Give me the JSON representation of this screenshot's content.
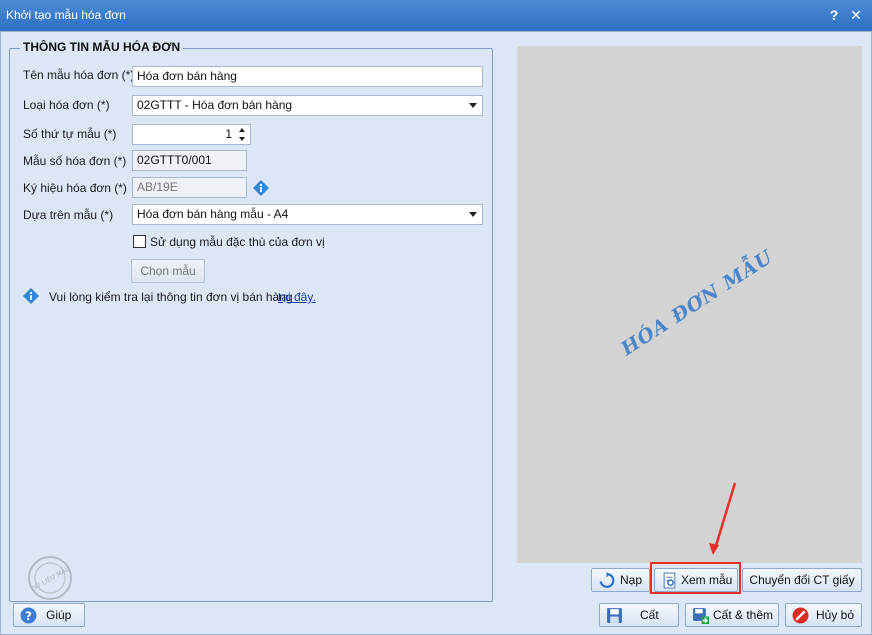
{
  "window": {
    "title": "Khởi tạo mẫu hóa đơn",
    "help_glyph": "?",
    "close_glyph": "✕"
  },
  "form": {
    "group_title": "THÔNG TIN MẪU HÓA ĐƠN",
    "ten_mau_label": "Tên mẫu hóa đơn (*)",
    "ten_mau_value": "Hóa đơn bán hàng",
    "loai_hd_label": "Loại hóa đơn (*)",
    "loai_hd_value": "02GTTT - Hóa đơn bán hàng",
    "so_thu_tu_label": "Số thứ tự mẫu (*)",
    "so_thu_tu_value": "1",
    "mau_so_label": "Mẫu số hóa đơn (*)",
    "mau_so_value": "02GTTT0/001",
    "ky_hieu_label": "Ký hiệu hóa đơn (*)",
    "ky_hieu_value": "AB/19E",
    "dua_tren_label": "Dựa trên mẫu (*)",
    "dua_tren_value": "Hóa đơn bán hàng mẫu - A4",
    "checkbox_label": "Sử dụng mẫu đặc thù của đơn vị",
    "chon_mau_label": "Chọn mẫu",
    "notice_text": "Vui lòng kiểm tra lại thông tin đơn vị bán hàng",
    "notice_link": "tại đây."
  },
  "preview": {
    "watermark": "HÓA ĐƠN MẪU"
  },
  "stamp_text": "DỮ LIỆU MẪU",
  "buttons": {
    "nap": "Nạp",
    "xem_mau": "Xem mẫu",
    "chuyen_doi": "Chuyển đổi CT giấy",
    "giup": "Giúp",
    "cat": "Cất",
    "cat_them": "Cất & thêm",
    "huy_bo": "Hủy bỏ"
  },
  "colors": {
    "title_bar": "#3a7bd0",
    "highlight": "#e8302a",
    "link": "#1a3fb5"
  }
}
